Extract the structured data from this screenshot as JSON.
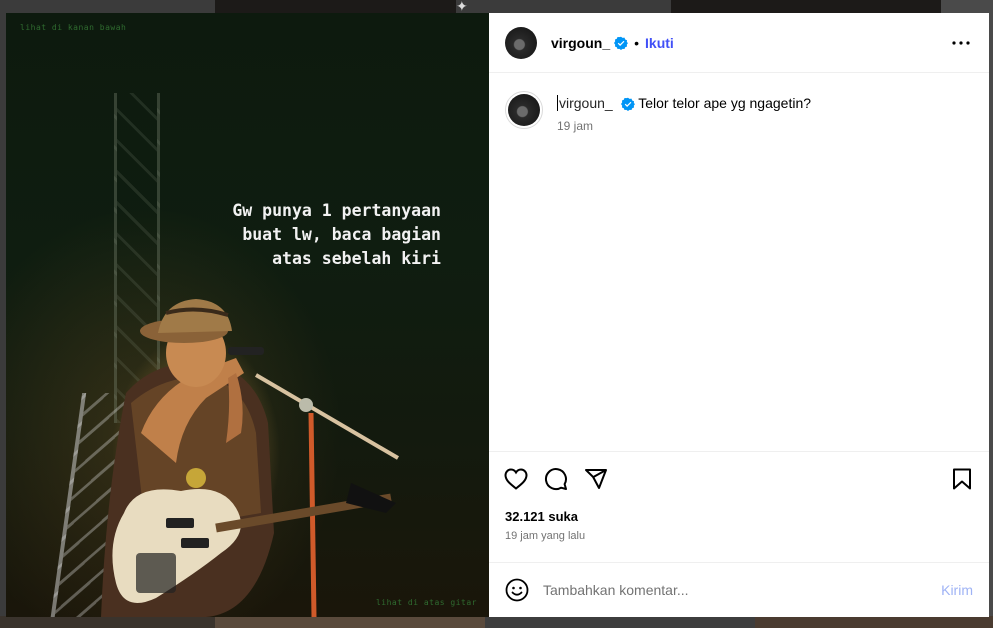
{
  "post": {
    "username": "virgoun_",
    "follow_label": "Ikuti",
    "separator": "•",
    "caption_username": "virgoun_",
    "caption_text": "Telor telor ape yg ngagetin?",
    "caption_time": "19 jam",
    "likes": "32.121 suka",
    "posted_ago": "19 jam yang lalu"
  },
  "media": {
    "corner_top_left": "lihat di kanan bawah",
    "corner_bottom_right": "lihat di atas gitar",
    "overlay_lines": [
      "Gw punya 1 pertanyaan",
      "buat lw, baca bagian",
      "atas sebelah kiri"
    ]
  },
  "comment_box": {
    "placeholder": "Tambahkan komentar...",
    "send_label": "Kirim"
  },
  "icons": {
    "verified": "verified-badge-icon",
    "more": "more-options-icon",
    "like": "heart-icon",
    "comment": "comment-icon",
    "share": "share-icon",
    "save": "bookmark-icon",
    "emoji": "emoji-icon"
  },
  "colors": {
    "verified": "#0095f6",
    "follow": "#4150f7",
    "send_disabled": "#9fb3f5"
  }
}
